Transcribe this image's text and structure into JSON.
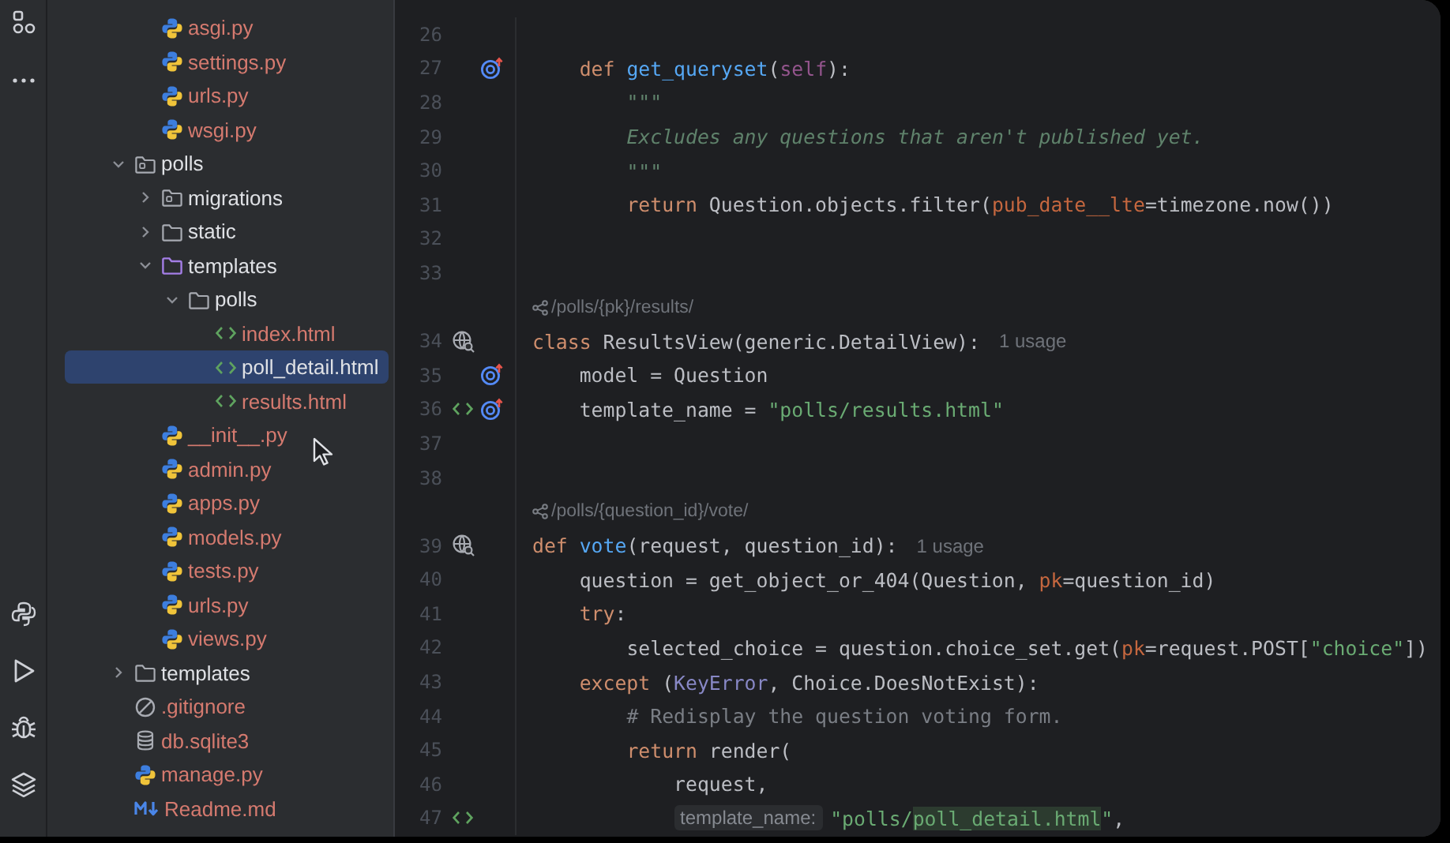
{
  "tool_strip": {
    "top": [
      {
        "kind": "structure"
      },
      {
        "kind": "more"
      }
    ],
    "bottom": [
      {
        "kind": "python"
      },
      {
        "kind": "run"
      },
      {
        "kind": "debug"
      },
      {
        "kind": "layers"
      }
    ]
  },
  "project_tree": {
    "leading_items": [
      {
        "name": "asgi.py",
        "kind": "python",
        "untracked": true,
        "selected": false
      },
      {
        "name": "settings.py",
        "kind": "python",
        "untracked": true,
        "selected": false
      },
      {
        "name": "urls.py",
        "kind": "python",
        "untracked": true,
        "selected": false
      },
      {
        "name": "wsgi.py",
        "kind": "python",
        "untracked": true,
        "selected": false
      }
    ],
    "items": [
      {
        "name": "polls",
        "kind": "package",
        "untracked": false,
        "selected": false,
        "expanded": true,
        "children": [
          {
            "name": "migrations",
            "kind": "package",
            "untracked": false,
            "selected": false,
            "expanded": false
          },
          {
            "name": "static",
            "kind": "folder",
            "untracked": false,
            "selected": false,
            "expanded": false
          },
          {
            "name": "templates",
            "kind": "templates",
            "untracked": false,
            "selected": false,
            "expanded": true,
            "children": [
              {
                "name": "polls",
                "kind": "folder",
                "untracked": false,
                "selected": false,
                "expanded": true,
                "children": [
                  {
                    "name": "index.html",
                    "kind": "html",
                    "untracked": true,
                    "selected": false
                  },
                  {
                    "name": "poll_detail.html",
                    "kind": "html",
                    "untracked": false,
                    "selected": true
                  },
                  {
                    "name": "results.html",
                    "kind": "html",
                    "untracked": true,
                    "selected": false
                  }
                ]
              }
            ]
          },
          {
            "name": "__init__.py",
            "kind": "python",
            "untracked": true,
            "selected": false
          },
          {
            "name": "admin.py",
            "kind": "python",
            "untracked": true,
            "selected": false
          },
          {
            "name": "apps.py",
            "kind": "python",
            "untracked": true,
            "selected": false
          },
          {
            "name": "models.py",
            "kind": "python",
            "untracked": true,
            "selected": false
          },
          {
            "name": "tests.py",
            "kind": "python",
            "untracked": true,
            "selected": false
          },
          {
            "name": "urls.py",
            "kind": "python",
            "untracked": true,
            "selected": false
          },
          {
            "name": "views.py",
            "kind": "python",
            "untracked": true,
            "selected": false
          }
        ]
      },
      {
        "name": "templates",
        "kind": "folder",
        "untracked": false,
        "selected": false,
        "expanded": false
      },
      {
        "name": ".gitignore",
        "kind": "ignore",
        "untracked": true,
        "selected": false
      },
      {
        "name": "db.sqlite3",
        "kind": "database",
        "untracked": true,
        "selected": false
      },
      {
        "name": "manage.py",
        "kind": "python",
        "untracked": true,
        "selected": false
      },
      {
        "name": "Readme.md",
        "kind": "markdown",
        "untracked": true,
        "selected": false
      }
    ]
  },
  "editor": {
    "lines": [
      {
        "kind": "code",
        "number": "26"
      },
      {
        "kind": "code",
        "number": "27",
        "gutter": [
          {
            "kind": "override"
          }
        ],
        "tokens": [
          {
            "kind": "kw",
            "text": "    def "
          },
          {
            "kind": "fn",
            "text": "get_queryset"
          },
          {
            "kind": "plain",
            "text": "("
          },
          {
            "kind": "self",
            "text": "self"
          },
          {
            "kind": "plain",
            "text": "):"
          }
        ]
      },
      {
        "kind": "code",
        "number": "28",
        "tokens": [
          {
            "kind": "doc",
            "text": "        \"\"\""
          }
        ]
      },
      {
        "kind": "code",
        "number": "29",
        "tokens": [
          {
            "kind": "doc",
            "text": "        Excludes any questions that aren't published yet."
          }
        ]
      },
      {
        "kind": "code",
        "number": "30",
        "tokens": [
          {
            "kind": "doc",
            "text": "        \"\"\""
          }
        ]
      },
      {
        "kind": "code",
        "number": "31",
        "tokens": [
          {
            "kind": "kw",
            "text": "        return "
          },
          {
            "kind": "plain",
            "text": "Question.objects.filter("
          },
          {
            "kind": "param",
            "text": "pub_date__lte"
          },
          {
            "kind": "plain",
            "text": "=timezone.now())"
          }
        ]
      },
      {
        "kind": "code",
        "number": "32"
      },
      {
        "kind": "code",
        "number": "33"
      },
      {
        "kind": "route",
        "text": "/polls/{pk}/results/"
      },
      {
        "kind": "code",
        "number": "34",
        "gutter": [
          {
            "kind": "usages"
          }
        ],
        "tokens": [
          {
            "kind": "kw",
            "text": "class "
          },
          {
            "kind": "plain",
            "text": "ResultsView(generic.DetailView):"
          },
          {
            "kind": "usage",
            "text": "1 usage"
          }
        ]
      },
      {
        "kind": "code",
        "number": "35",
        "gutter": [
          {
            "kind": "override"
          }
        ],
        "tokens": [
          {
            "kind": "plain",
            "text": "    model = Question"
          }
        ]
      },
      {
        "kind": "code",
        "number": "36",
        "gutter": [
          {
            "kind": "html"
          },
          {
            "kind": "override"
          }
        ],
        "tokens": [
          {
            "kind": "plain",
            "text": "    template_name = "
          },
          {
            "kind": "str",
            "text": "\"polls/results.html\""
          }
        ]
      },
      {
        "kind": "code",
        "number": "37"
      },
      {
        "kind": "code",
        "number": "38"
      },
      {
        "kind": "route",
        "text": "/polls/{question_id}/vote/"
      },
      {
        "kind": "code",
        "number": "39",
        "gutter": [
          {
            "kind": "usages"
          }
        ],
        "tokens": [
          {
            "kind": "kw",
            "text": "def "
          },
          {
            "kind": "fn",
            "text": "vote"
          },
          {
            "kind": "plain",
            "text": "(request, question_id):"
          },
          {
            "kind": "usage",
            "text": "1 usage"
          }
        ]
      },
      {
        "kind": "code",
        "number": "40",
        "tokens": [
          {
            "kind": "plain",
            "text": "    question = get_object_or_404(Question, "
          },
          {
            "kind": "param",
            "text": "pk"
          },
          {
            "kind": "plain",
            "text": "=question_id)"
          }
        ]
      },
      {
        "kind": "code",
        "number": "41",
        "tokens": [
          {
            "kind": "kw",
            "text": "    try"
          },
          {
            "kind": "plain",
            "text": ":"
          }
        ]
      },
      {
        "kind": "code",
        "number": "42",
        "tokens": [
          {
            "kind": "plain",
            "text": "        selected_choice = question.choice_set.get("
          },
          {
            "kind": "param",
            "text": "pk"
          },
          {
            "kind": "plain",
            "text": "=request.POST["
          },
          {
            "kind": "str",
            "text": "\"choice\""
          },
          {
            "kind": "plain",
            "text": "])"
          }
        ]
      },
      {
        "kind": "code",
        "number": "43",
        "tokens": [
          {
            "kind": "kw",
            "text": "    except "
          },
          {
            "kind": "plain",
            "text": "("
          },
          {
            "kind": "builtin",
            "text": "KeyError"
          },
          {
            "kind": "plain",
            "text": ", Choice.DoesNotExist):"
          }
        ]
      },
      {
        "kind": "code",
        "number": "44",
        "tokens": [
          {
            "kind": "comment",
            "text": "        # Redisplay the question voting form."
          }
        ]
      },
      {
        "kind": "code",
        "number": "45",
        "tokens": [
          {
            "kind": "kw",
            "text": "        return "
          },
          {
            "kind": "plain",
            "text": "render("
          }
        ]
      },
      {
        "kind": "code",
        "number": "46",
        "tokens": [
          {
            "kind": "plain",
            "text": "            request,"
          }
        ]
      },
      {
        "kind": "code",
        "number": "47",
        "gutter": [
          {
            "kind": "html"
          }
        ],
        "tokens": [
          {
            "kind": "hint",
            "text": "template_name:"
          },
          {
            "kind": "str",
            "text": "\"polls/"
          },
          {
            "kind": "match",
            "text": "poll_detail.html"
          },
          {
            "kind": "str",
            "text": "\""
          },
          {
            "kind": "plain",
            "text": ","
          }
        ]
      }
    ]
  }
}
